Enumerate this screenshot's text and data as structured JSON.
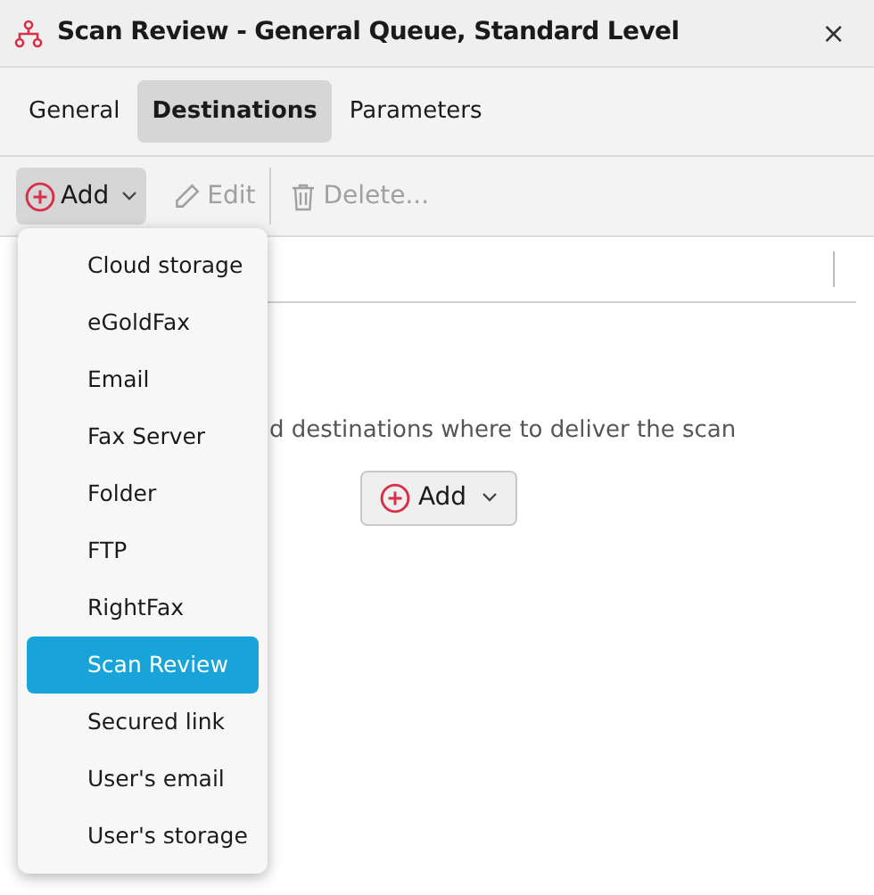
{
  "window": {
    "title": "Scan Review - General Queue, Standard Level",
    "close": "×"
  },
  "tabs": [
    {
      "label": "General",
      "selected": false
    },
    {
      "label": "Destinations",
      "selected": true
    },
    {
      "label": "Parameters",
      "selected": false
    }
  ],
  "toolbar": [
    {
      "kind": "add",
      "label": "Add",
      "disabled": false
    },
    {
      "kind": "edit",
      "label": "Edit",
      "disabled": true
    },
    {
      "kind": "delete",
      "label": "Delete...",
      "disabled": true
    }
  ],
  "empty_message": "d destinations where to deliver the scan",
  "add_button": {
    "label": "Add"
  },
  "menu": [
    {
      "label": "Cloud storage",
      "selected": false
    },
    {
      "label": "eGoldFax",
      "selected": false
    },
    {
      "label": "Email",
      "selected": false
    },
    {
      "label": "Fax Server",
      "selected": false
    },
    {
      "label": "Folder",
      "selected": false
    },
    {
      "label": "FTP",
      "selected": false
    },
    {
      "label": "RightFax",
      "selected": false
    },
    {
      "label": "Scan Review",
      "selected": true
    },
    {
      "label": "Secured link",
      "selected": false
    },
    {
      "label": "User's email",
      "selected": false
    },
    {
      "label": "User's storage",
      "selected": false
    }
  ]
}
